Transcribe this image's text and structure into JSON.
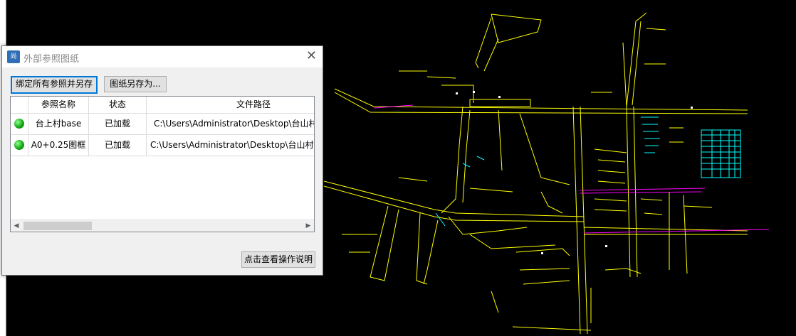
{
  "dialog": {
    "title": "外部参照图纸",
    "app_icon_text": "尚",
    "bind_all_button": "绑定所有参照并另存",
    "save_as_button": "图纸另存为...",
    "help_button": "点击查看操作说明",
    "columns": [
      "参照名称",
      "状态",
      "文件路径"
    ],
    "rows": [
      {
        "name": "台上村base",
        "status": "已加载",
        "path": "C:\\Users\\Administrator\\Desktop\\台山村"
      },
      {
        "name": "A0+0.25图框",
        "status": "已加载",
        "path": "C:\\Users\\Administrator\\Desktop\\台山村"
      }
    ],
    "colors": {
      "status_ok": "#19b019",
      "accent": "#0078d7"
    }
  },
  "drawing": {
    "colors": {
      "primary": "#ffff00",
      "secondary": "#00ffff",
      "magenta": "#ff00ff",
      "white": "#ffffff"
    }
  }
}
